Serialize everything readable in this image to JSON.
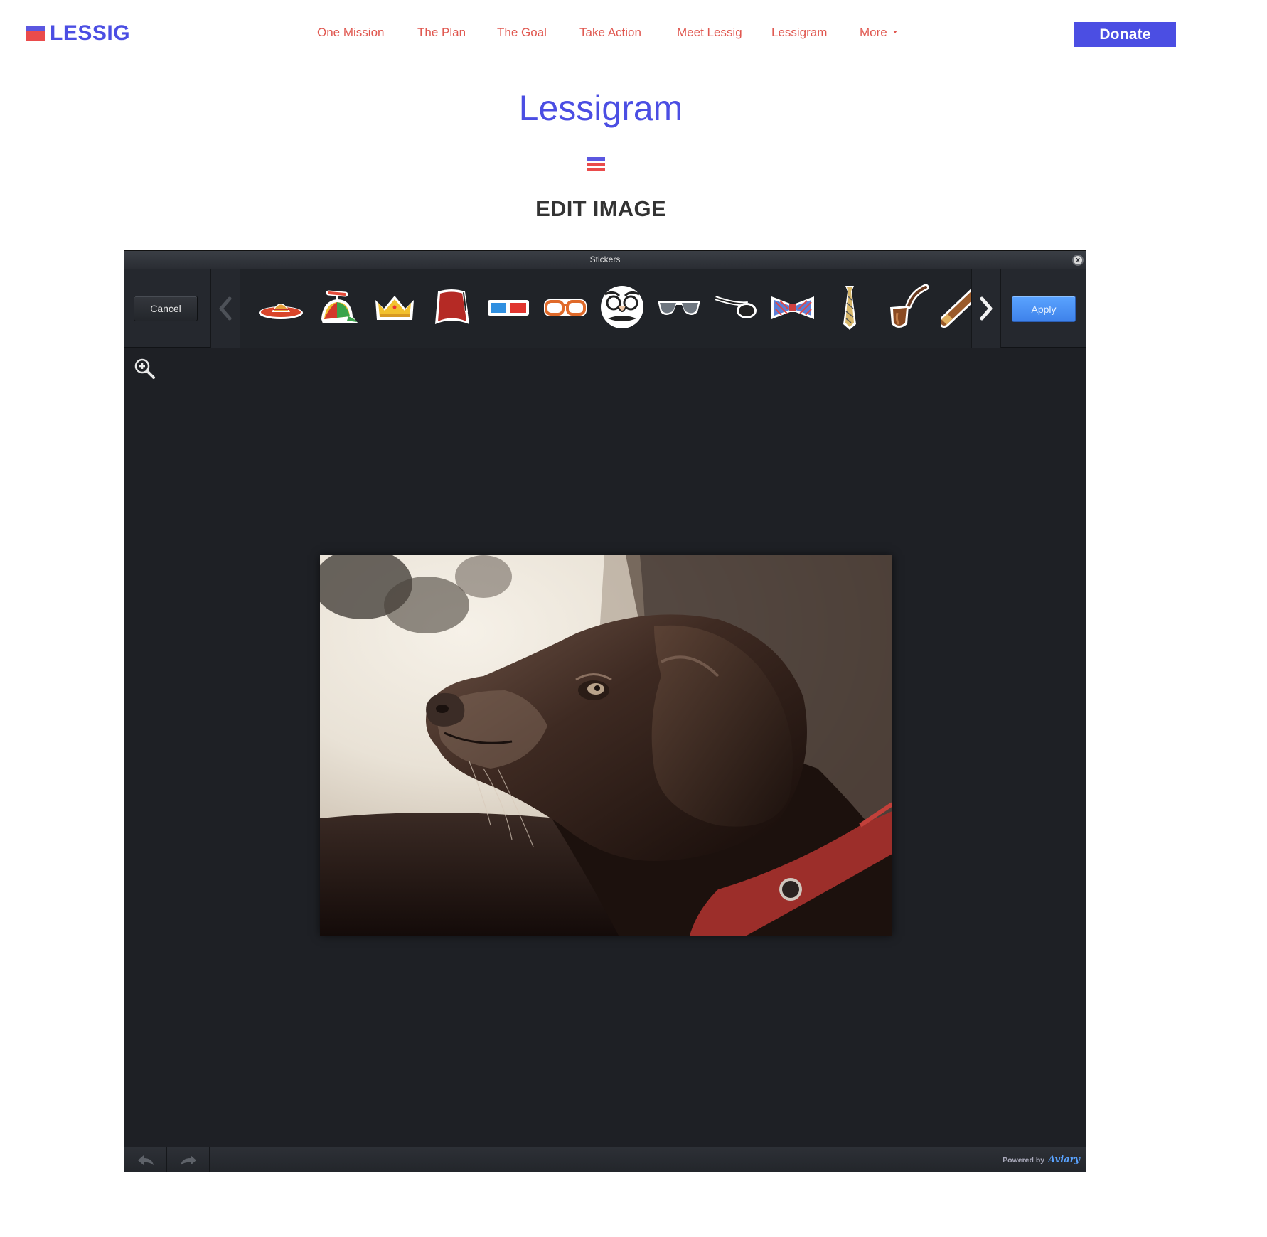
{
  "header": {
    "logo_text": "LESSIG",
    "nav": [
      {
        "label": "One Mission"
      },
      {
        "label": "The Plan"
      },
      {
        "label": "The Goal"
      },
      {
        "label": "Take Action"
      },
      {
        "label": "Meet Lessig"
      },
      {
        "label": "Lessigram"
      },
      {
        "label": "More"
      }
    ],
    "donate_label": "Donate"
  },
  "page": {
    "title": "Lessigram",
    "section_title": "EDIT IMAGE"
  },
  "editor": {
    "panel_title": "Stickers",
    "close_label": "x",
    "cancel_label": "Cancel",
    "apply_label": "Apply",
    "stickers": [
      {
        "icon": "sombrero-icon"
      },
      {
        "icon": "propeller-cap-icon"
      },
      {
        "icon": "crown-icon"
      },
      {
        "icon": "fez-icon"
      },
      {
        "icon": "3d-glasses-icon"
      },
      {
        "icon": "orange-glasses-icon"
      },
      {
        "icon": "groucho-glasses-icon"
      },
      {
        "icon": "aviator-sunglasses-icon"
      },
      {
        "icon": "eye-patch-icon"
      },
      {
        "icon": "bow-tie-icon"
      },
      {
        "icon": "necktie-icon"
      },
      {
        "icon": "pipe-icon"
      },
      {
        "icon": "cigar-icon"
      }
    ],
    "powered_by_label": "Powered by",
    "powered_by_brand": "Aviary"
  },
  "colors": {
    "brand_blue": "#4b4ee3",
    "nav_red": "#e0574f",
    "editor_bg": "#1e2025",
    "apply_blue": "#4a90f0"
  }
}
